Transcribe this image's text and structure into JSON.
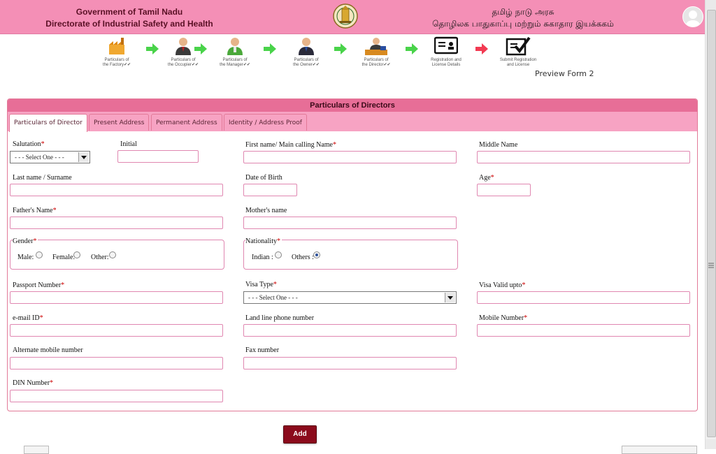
{
  "header": {
    "en_line1": "Government of Tamil Nadu",
    "en_line2": "Directorate of Industrial Safety and Health",
    "ta_line1": "தமிழ் நாடு அரசு",
    "ta_line2": "தொழிலக பாதுகாப்பு மற்றும் சுகாதார இயக்ககம்"
  },
  "steps": [
    {
      "line1": "Particulars of",
      "line2": "the Factory✔✔"
    },
    {
      "line1": "Particulars of",
      "line2": "the Occupier✔✔"
    },
    {
      "line1": "Particulars of",
      "line2": "the Manager✔✔"
    },
    {
      "line1": "Particulars of",
      "line2": "the Owner✔✔"
    },
    {
      "line1": "Particulars of",
      "line2": "the Director✔✔"
    },
    {
      "line1": "Registration and",
      "line2": "License Details"
    },
    {
      "line1": "Submit Registration",
      "line2": "and License"
    }
  ],
  "preview_label": "Preview Form 2",
  "panel_title": "Particulars of Directors",
  "tabs": [
    "Particulars of Director",
    "Present Address",
    "Permanent Address",
    "Identity / Address Proof"
  ],
  "fields": {
    "salutation": "Salutation",
    "salutation_value": "- - - Select One - - -",
    "initial": "Initial",
    "first_name": "First name/ Main calling Name",
    "middle_name": "Middle Name",
    "last_name": "Last name / Surname",
    "dob": "Date of Birth",
    "age": "Age",
    "father": "Father's Name",
    "mother": "Mother's name",
    "gender": "Gender",
    "nationality": "Nationality",
    "passport": "Passport Number",
    "visa_type": "Visa Type",
    "visa_type_value": "- - - Select One - - -",
    "visa_valid": "Visa Valid upto",
    "email": "e-mail ID",
    "landline": "Land line phone number",
    "mobile": "Mobile Number",
    "alt_mobile": "Alternate mobile number",
    "fax": "Fax number",
    "din": "DIN Number"
  },
  "gender_options": {
    "male": "Male:",
    "female": "Female:",
    "other": "Other:"
  },
  "nationality_options": {
    "indian": "Indian :",
    "others": "Others :"
  },
  "nationality_selected": "Others",
  "add_label": "Add",
  "required_mark": "*"
}
